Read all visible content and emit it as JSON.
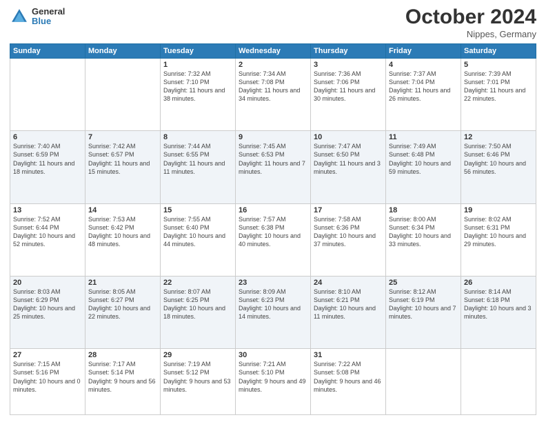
{
  "header": {
    "logo": {
      "general": "General",
      "blue": "Blue"
    },
    "title": "October 2024",
    "subtitle": "Nippes, Germany"
  },
  "weekdays": [
    "Sunday",
    "Monday",
    "Tuesday",
    "Wednesday",
    "Thursday",
    "Friday",
    "Saturday"
  ],
  "weeks": [
    [
      {
        "day": "",
        "info": ""
      },
      {
        "day": "",
        "info": ""
      },
      {
        "day": "1",
        "info": "Sunrise: 7:32 AM\nSunset: 7:10 PM\nDaylight: 11 hours and 38 minutes."
      },
      {
        "day": "2",
        "info": "Sunrise: 7:34 AM\nSunset: 7:08 PM\nDaylight: 11 hours and 34 minutes."
      },
      {
        "day": "3",
        "info": "Sunrise: 7:36 AM\nSunset: 7:06 PM\nDaylight: 11 hours and 30 minutes."
      },
      {
        "day": "4",
        "info": "Sunrise: 7:37 AM\nSunset: 7:04 PM\nDaylight: 11 hours and 26 minutes."
      },
      {
        "day": "5",
        "info": "Sunrise: 7:39 AM\nSunset: 7:01 PM\nDaylight: 11 hours and 22 minutes."
      }
    ],
    [
      {
        "day": "6",
        "info": "Sunrise: 7:40 AM\nSunset: 6:59 PM\nDaylight: 11 hours and 18 minutes."
      },
      {
        "day": "7",
        "info": "Sunrise: 7:42 AM\nSunset: 6:57 PM\nDaylight: 11 hours and 15 minutes."
      },
      {
        "day": "8",
        "info": "Sunrise: 7:44 AM\nSunset: 6:55 PM\nDaylight: 11 hours and 11 minutes."
      },
      {
        "day": "9",
        "info": "Sunrise: 7:45 AM\nSunset: 6:53 PM\nDaylight: 11 hours and 7 minutes."
      },
      {
        "day": "10",
        "info": "Sunrise: 7:47 AM\nSunset: 6:50 PM\nDaylight: 11 hours and 3 minutes."
      },
      {
        "day": "11",
        "info": "Sunrise: 7:49 AM\nSunset: 6:48 PM\nDaylight: 10 hours and 59 minutes."
      },
      {
        "day": "12",
        "info": "Sunrise: 7:50 AM\nSunset: 6:46 PM\nDaylight: 10 hours and 56 minutes."
      }
    ],
    [
      {
        "day": "13",
        "info": "Sunrise: 7:52 AM\nSunset: 6:44 PM\nDaylight: 10 hours and 52 minutes."
      },
      {
        "day": "14",
        "info": "Sunrise: 7:53 AM\nSunset: 6:42 PM\nDaylight: 10 hours and 48 minutes."
      },
      {
        "day": "15",
        "info": "Sunrise: 7:55 AM\nSunset: 6:40 PM\nDaylight: 10 hours and 44 minutes."
      },
      {
        "day": "16",
        "info": "Sunrise: 7:57 AM\nSunset: 6:38 PM\nDaylight: 10 hours and 40 minutes."
      },
      {
        "day": "17",
        "info": "Sunrise: 7:58 AM\nSunset: 6:36 PM\nDaylight: 10 hours and 37 minutes."
      },
      {
        "day": "18",
        "info": "Sunrise: 8:00 AM\nSunset: 6:34 PM\nDaylight: 10 hours and 33 minutes."
      },
      {
        "day": "19",
        "info": "Sunrise: 8:02 AM\nSunset: 6:31 PM\nDaylight: 10 hours and 29 minutes."
      }
    ],
    [
      {
        "day": "20",
        "info": "Sunrise: 8:03 AM\nSunset: 6:29 PM\nDaylight: 10 hours and 25 minutes."
      },
      {
        "day": "21",
        "info": "Sunrise: 8:05 AM\nSunset: 6:27 PM\nDaylight: 10 hours and 22 minutes."
      },
      {
        "day": "22",
        "info": "Sunrise: 8:07 AM\nSunset: 6:25 PM\nDaylight: 10 hours and 18 minutes."
      },
      {
        "day": "23",
        "info": "Sunrise: 8:09 AM\nSunset: 6:23 PM\nDaylight: 10 hours and 14 minutes."
      },
      {
        "day": "24",
        "info": "Sunrise: 8:10 AM\nSunset: 6:21 PM\nDaylight: 10 hours and 11 minutes."
      },
      {
        "day": "25",
        "info": "Sunrise: 8:12 AM\nSunset: 6:19 PM\nDaylight: 10 hours and 7 minutes."
      },
      {
        "day": "26",
        "info": "Sunrise: 8:14 AM\nSunset: 6:18 PM\nDaylight: 10 hours and 3 minutes."
      }
    ],
    [
      {
        "day": "27",
        "info": "Sunrise: 7:15 AM\nSunset: 5:16 PM\nDaylight: 10 hours and 0 minutes."
      },
      {
        "day": "28",
        "info": "Sunrise: 7:17 AM\nSunset: 5:14 PM\nDaylight: 9 hours and 56 minutes."
      },
      {
        "day": "29",
        "info": "Sunrise: 7:19 AM\nSunset: 5:12 PM\nDaylight: 9 hours and 53 minutes."
      },
      {
        "day": "30",
        "info": "Sunrise: 7:21 AM\nSunset: 5:10 PM\nDaylight: 9 hours and 49 minutes."
      },
      {
        "day": "31",
        "info": "Sunrise: 7:22 AM\nSunset: 5:08 PM\nDaylight: 9 hours and 46 minutes."
      },
      {
        "day": "",
        "info": ""
      },
      {
        "day": "",
        "info": ""
      }
    ]
  ]
}
